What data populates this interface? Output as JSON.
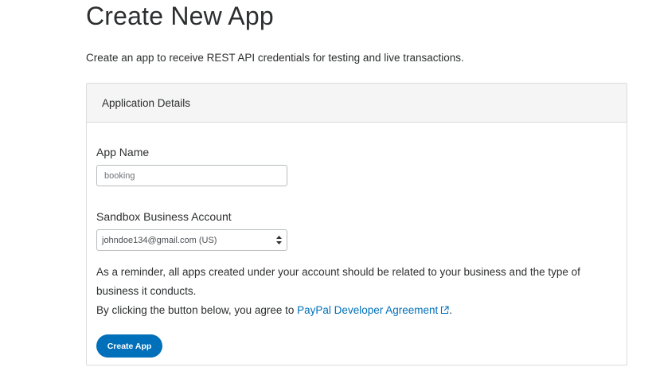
{
  "page": {
    "title": "Create New App",
    "subtitle": "Create an app to receive REST API credentials for testing and live transactions."
  },
  "card": {
    "header": "Application Details",
    "app_name": {
      "label": "App Name",
      "value": "booking"
    },
    "sandbox_account": {
      "label": "Sandbox Business Account",
      "selected": "johndoe134@gmail.com (US)"
    },
    "reminder": "As a reminder, all apps created under your account should be related to your business and the type of business it conducts.",
    "agreement_prefix": "By clicking the button below, you agree to ",
    "agreement_link": "PayPal Developer Agreement",
    "agreement_suffix": ".",
    "submit_label": "Create App"
  },
  "colors": {
    "accent": "#0070ba",
    "header_bg": "#f5f5f5",
    "border": "#dcdcdc"
  },
  "icons": {
    "link": "external-link-icon",
    "select": "select-arrows-icon"
  }
}
